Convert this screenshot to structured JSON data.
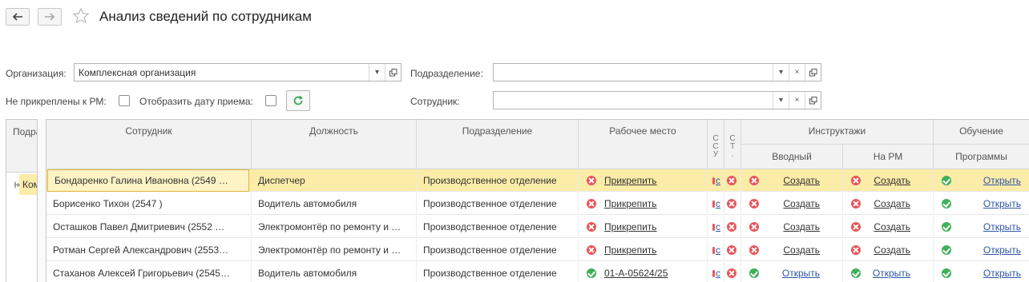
{
  "header": {
    "title": "Анализ сведений по сотрудникам"
  },
  "filters": {
    "organization_label": "Организация:",
    "organization_value": "Комплексная организация",
    "department_label": "Подразделение:",
    "department_value": "",
    "not_attached_label": "Не прикреплены к РМ:",
    "show_hire_date_label": "Отобразить дату приема:",
    "employee_label": "Сотрудник:",
    "employee_value": ""
  },
  "left_panel": {
    "header": "Подразделение",
    "row": "Комплексная организация"
  },
  "table": {
    "headers": {
      "employee": "Сотрудник",
      "position": "Должность",
      "department": "Подразделение",
      "workplace": "Рабочее место",
      "narrow1": [
        "С",
        "С",
        "У"
      ],
      "narrow2": [
        "С",
        "Т",
        "."
      ],
      "briefings": "Инструктажи",
      "intro": "Вводный",
      "on_rm": "На РМ",
      "training": "Обучение",
      "programs": "Программы"
    },
    "rows": [
      {
        "employee": "Бондаренко Галина  Ивановна (2549 …",
        "position": "Диспетчер",
        "department": "Производственное отделение",
        "workplace_status": "red",
        "workplace": "Прикрепить",
        "n1": "с",
        "intro_status": "red",
        "intro": "Создать",
        "rm_status": "red",
        "rm": "Создать",
        "prog_status": "green",
        "prog": "Открыть"
      },
      {
        "employee": "Борисенко Тихон  (2547        )",
        "position": "Водитель автомобиля",
        "department": "Производственное отделение",
        "workplace_status": "red",
        "workplace": "Прикрепить",
        "n1": "с",
        "intro_status": "red",
        "intro": "Создать",
        "rm_status": "red",
        "rm": "Создать",
        "prog_status": "green",
        "prog": "Открыть"
      },
      {
        "employee": "Осташков Павел Дмитриевич (2552 …",
        "position": "Электромонтёр по ремонту и …",
        "department": "Производственное отделение",
        "workplace_status": "red",
        "workplace": "Прикрепить",
        "n1": "с",
        "intro_status": "red",
        "intro": "Создать",
        "rm_status": "red",
        "rm": "Создать",
        "prog_status": "green",
        "prog": "Открыть"
      },
      {
        "employee": "Ротман Сергей Александрович (2553…",
        "position": "Электромонтёр по ремонту и …",
        "department": "Производственное отделение",
        "workplace_status": "red",
        "workplace": "Прикрепить",
        "n1": "с",
        "intro_status": "red",
        "intro": "Создать",
        "rm_status": "red",
        "rm": "Создать",
        "prog_status": "green",
        "prog": "Открыть"
      },
      {
        "employee": "Стаханов Алексей Григорьевич (2545…",
        "position": "Водитель автомобиля",
        "department": "Производственное отделение",
        "workplace_status": "green",
        "workplace": "01-А-05624/25",
        "n1": "с",
        "intro_status": "green",
        "intro": "Открыть",
        "rm_status": "green",
        "rm": "Открыть",
        "prog_status": "green",
        "prog": "Открыть"
      }
    ]
  }
}
